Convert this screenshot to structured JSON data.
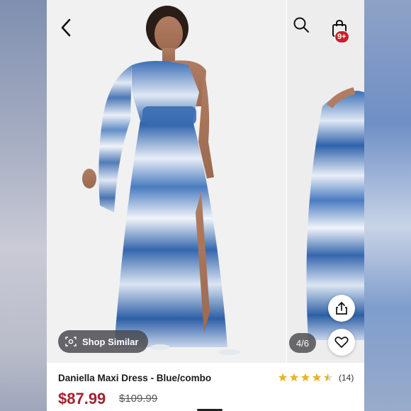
{
  "header": {
    "back_icon": "chevron-left-icon",
    "search_icon": "search-icon",
    "bag_icon": "shopping-bag-icon",
    "bag_badge": "9+"
  },
  "gallery": {
    "shop_similar_label": "Shop Similar",
    "pager": "4/6"
  },
  "product": {
    "title": "Daniella Maxi Dress - Blue/combo",
    "price": "$87.99",
    "original_price": "$109.99",
    "rating_value": 4.5,
    "review_count": "(14)"
  },
  "colors": {
    "price_red": "#a8202c",
    "badge_red": "#c8202c",
    "star_gold": "#e9b324",
    "dress_blue": "#3a6fb5"
  }
}
